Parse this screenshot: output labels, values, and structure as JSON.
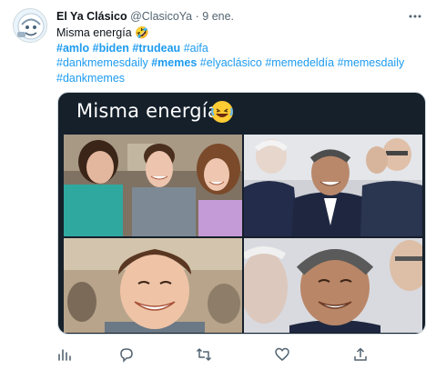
{
  "tweet": {
    "display_name": "El Ya Clásico",
    "handle": "@ClasicoYa",
    "separator": "·",
    "date": "9 ene.",
    "text": "Misma energía",
    "text_emoji": "🤣",
    "hashtags_line1": [
      {
        "text": "#amlo",
        "bold": true
      },
      {
        "text": "#biden",
        "bold": true
      },
      {
        "text": "#trudeau",
        "bold": true
      },
      {
        "text": "#aifa",
        "bold": false
      }
    ],
    "hashtags_line2": [
      {
        "text": "#dankmemesdaily",
        "bold": false
      },
      {
        "text": "#memes",
        "bold": true
      },
      {
        "text": "#elyaclásico",
        "bold": false
      },
      {
        "text": "#memedeldía",
        "bold": false
      },
      {
        "text": "#memesdaily",
        "bold": false
      }
    ],
    "hashtags_line3": [
      {
        "text": "#dankmemes",
        "bold": false
      }
    ],
    "media": {
      "caption": "Misma energía",
      "caption_emoji": "laughing-emoji"
    }
  },
  "icons": {
    "more": "more-dots-icon",
    "analytics": "analytics-icon",
    "reply": "reply-icon",
    "retweet": "retweet-icon",
    "like": "heart-icon",
    "share": "share-icon"
  },
  "colors": {
    "link": "#1d9bf0",
    "secondary": "#536471",
    "media_bg": "#15202b"
  }
}
